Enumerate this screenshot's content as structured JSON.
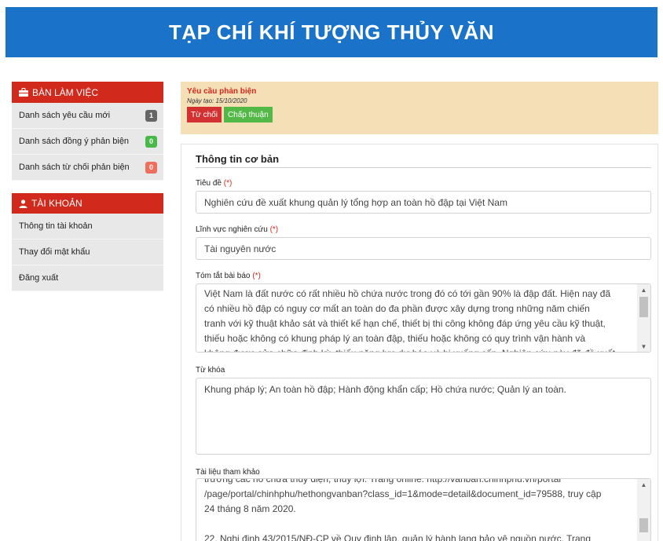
{
  "header": {
    "title": "TẠP CHÍ KHÍ TƯỢNG THỦY VĂN"
  },
  "sidebar": {
    "workspace": {
      "title": "BÀN LÀM VIỆC",
      "items": [
        {
          "label": "Danh sách yêu cầu mới",
          "count": "1"
        },
        {
          "label": "Danh sách đồng ý phản biện",
          "count": "0"
        },
        {
          "label": "Danh sách từ chối phản biện",
          "count": "0"
        }
      ]
    },
    "account": {
      "title": "TÀI KHOẢN",
      "items": [
        {
          "label": "Thông tin tài khoản"
        },
        {
          "label": "Thay đổi mật khẩu"
        },
        {
          "label": "Đăng xuất"
        }
      ]
    }
  },
  "request": {
    "title": "Yêu cầu phản biện",
    "date": "Ngày tạo: 15/10/2020",
    "reject_label": "Từ chối",
    "accept_label": "Chấp thuận"
  },
  "form": {
    "section_title": "Thông tin cơ bản",
    "required_mark": "(*)",
    "title_label": "Tiêu đề",
    "title_value": "Nghiên cứu đề xuất khung quản lý tổng hợp an toàn hồ đập tại Việt Nam",
    "field_label": "Lĩnh vực nghiên cứu",
    "field_value": "Tài nguyên nước",
    "abstract_label": "Tóm tắt bài báo",
    "abstract_lines": [
      "Việt Nam là đất nước có rất nhiều hồ chứa nước trong đó có tới gần 90% là đập đất. Hiện nay đã",
      "có nhiều hồ đập có nguy cơ mất an toàn do đa phần được xây dựng trong những năm chiến",
      "tranh với kỹ thuật khảo sát và thiết kế hạn chế, thiết bị thi công không đáp ứng yêu cầu kỹ thuật,",
      "thiếu hoặc không có khung pháp lý an toàn đập, thiếu hoặc không có quy trình vận hành và",
      "không được sửa chữa định kỳ, thiếu năng lực dự báo và bị xuống cấp. Nghiên cứu này đã đề xuất"
    ],
    "keywords_label": "Từ khóa",
    "keywords_value": "Khung pháp lý; An toàn hồ đập; Hành động khẩn cấp; Hồ chứa nước; Quản lý an toàn.",
    "references_label": "Tài liệu tham khảo",
    "references_lines": [
      "trường các hồ chứa thủy điện, thủy lợi. Trang online: http://vanban.chinhphu.vn/portal",
      "/page/portal/chinhphu/hethongvanban?class_id=1&mode=detail&document_id=79588, truy cập",
      "24 tháng 8 năm 2020.",
      "",
      "22. Nghị định 43/2015/NĐ-CP về Quy định lập, quản lý hành lang bảo vệ nguồn nước. Trang"
    ]
  },
  "colors": {
    "banner": "#1a73c8",
    "sidebar_header": "#d1291c",
    "alert_bg": "#f5dfb7",
    "accept": "#52b947",
    "reject": "#d33131"
  }
}
